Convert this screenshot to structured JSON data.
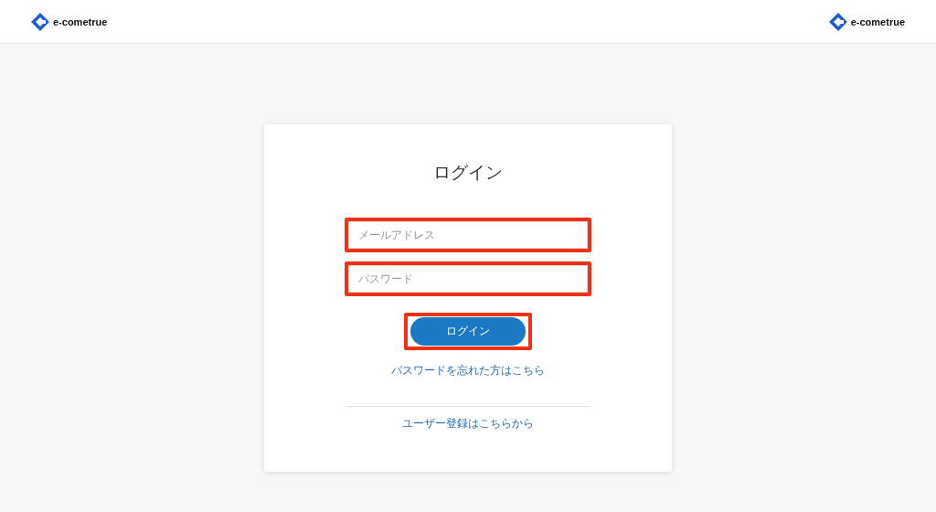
{
  "header": {
    "logo_left": "e-cometrue",
    "logo_right": "e-cometrue"
  },
  "login": {
    "title": "ログイン",
    "fields": [
      {
        "placeholder": "メールアドレス",
        "highlighted": true
      },
      {
        "placeholder": "パスワード",
        "highlighted": true
      }
    ],
    "button": {
      "label": "ログイン",
      "highlighted": true
    },
    "forgot_link": "パスワードを忘れた方はこちら",
    "register_link": "ユーザー登録はこちらから"
  }
}
